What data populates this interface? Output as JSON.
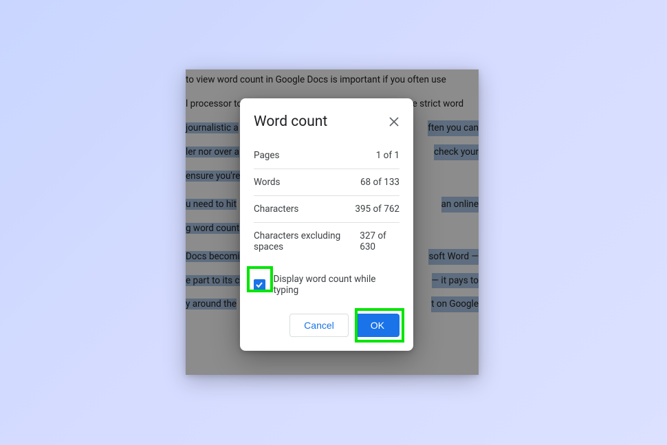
{
  "document": {
    "paragraph1": " to view word count in Google Docs is important if you often use",
    "paragraph2_pre": "l processor to write. School or college essays often have strict word",
    "paragraph2_post_a": " journalistic a",
    "paragraph2_post_b": "ften you can",
    "paragraph3_a": "ler nor over a",
    "paragraph3_b": " check your",
    "paragraph4": "ensure you're",
    "paragraph5_a": "u need to hit ",
    "paragraph5_b": "an online",
    "paragraph6": "g word count ",
    "paragraph7_a": "Docs becomi",
    "paragraph7_b": "soft Word —",
    "paragraph8_a": "e part to its c",
    "paragraph8_b": " — it pays to",
    "paragraph9_a": "y around the ",
    "paragraph9_b": "t on Google"
  },
  "dialog": {
    "title": "Word count",
    "stats": [
      {
        "label": "Pages",
        "value": "1 of 1"
      },
      {
        "label": "Words",
        "value": "68 of 133"
      },
      {
        "label": "Characters",
        "value": "395 of 762"
      },
      {
        "label": "Characters excluding spaces",
        "value": "327 of 630"
      }
    ],
    "checkbox_label": "Display word count while typing",
    "checkbox_checked": true,
    "cancel_label": "Cancel",
    "ok_label": "OK"
  }
}
